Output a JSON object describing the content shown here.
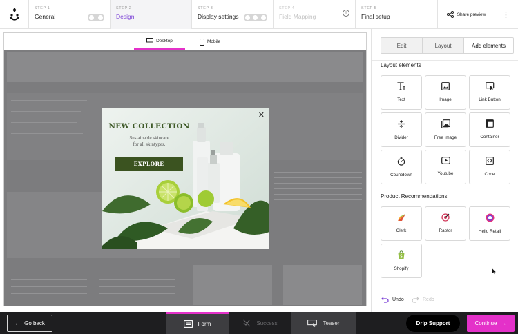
{
  "steps": [
    {
      "label": "STEP 1",
      "name": "General"
    },
    {
      "label": "STEP 2",
      "name": "Design"
    },
    {
      "label": "STEP 3",
      "name": "Display settings"
    },
    {
      "label": "STEP 4",
      "name": "Field Mapping"
    },
    {
      "label": "STEP 5",
      "name": "Final setup"
    }
  ],
  "header": {
    "share_label": "Share preview",
    "more_icon": "kebab-icon"
  },
  "devices": {
    "desktop": "Desktop",
    "mobile": "Mobile"
  },
  "popup": {
    "title": "NEW COLLECTION",
    "subtitle_line1": "Sustainable skincare",
    "subtitle_line2": "for all skintypes.",
    "button": "EXPLORE",
    "accent": "#3b5320"
  },
  "panel": {
    "tabs": [
      "Edit",
      "Layout",
      "Add elements"
    ],
    "layout_title": "Layout elements",
    "layout_elements": [
      "Text",
      "Image",
      "Link Button",
      "Divider",
      "Free Image",
      "Container",
      "Countdown",
      "Youtube",
      "Code"
    ],
    "product_title": "Product Recommendations",
    "product_elements": [
      "Clerk",
      "Raptor",
      "Hello Retail",
      "Shopify"
    ],
    "undo": "Undo",
    "redo": "Redo"
  },
  "bottom": {
    "go_back": "Go back",
    "tabs": [
      "Form",
      "Success",
      "Teaser"
    ],
    "drip_support": "Drip Support",
    "continue": "Continue"
  },
  "colors": {
    "accent": "#e431c9",
    "active_step": "#7a3fd6",
    "dark_bar": "#1e1e20"
  }
}
